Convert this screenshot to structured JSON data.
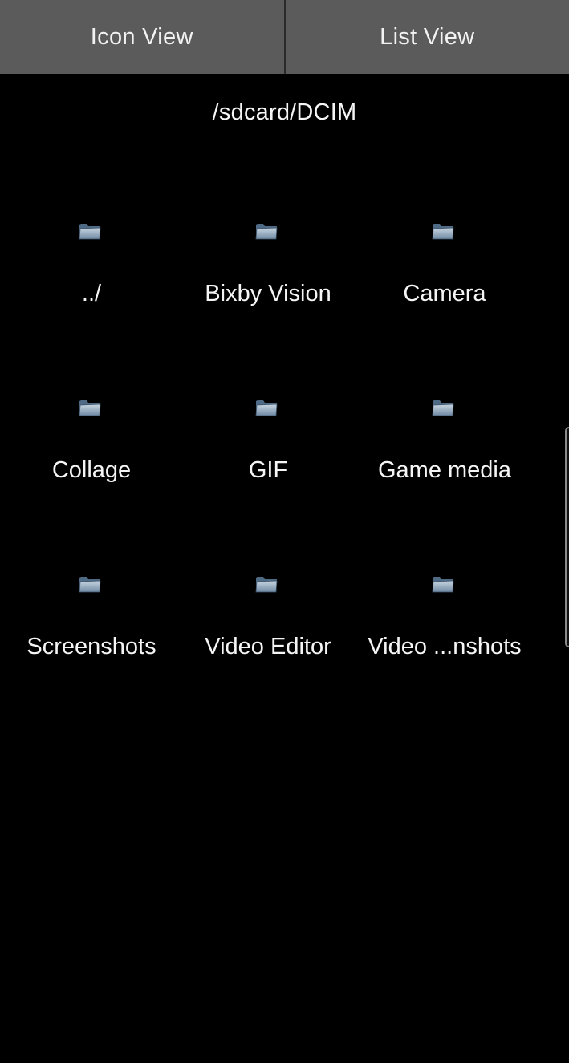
{
  "toolbar": {
    "icon_view_label": "Icon View",
    "list_view_label": "List View"
  },
  "current_path": "/sdcard/DCIM",
  "items": [
    {
      "label": "../",
      "icon": "folder-icon"
    },
    {
      "label": "Bixby Vision",
      "icon": "folder-icon"
    },
    {
      "label": "Camera",
      "icon": "folder-icon"
    },
    {
      "label": "Collage",
      "icon": "folder-icon"
    },
    {
      "label": "GIF",
      "icon": "folder-icon"
    },
    {
      "label": "Game media",
      "icon": "folder-icon"
    },
    {
      "label": "Screenshots",
      "icon": "folder-icon"
    },
    {
      "label": "Video Editor",
      "icon": "folder-icon"
    },
    {
      "label": "Video ...nshots",
      "icon": "folder-icon"
    }
  ]
}
